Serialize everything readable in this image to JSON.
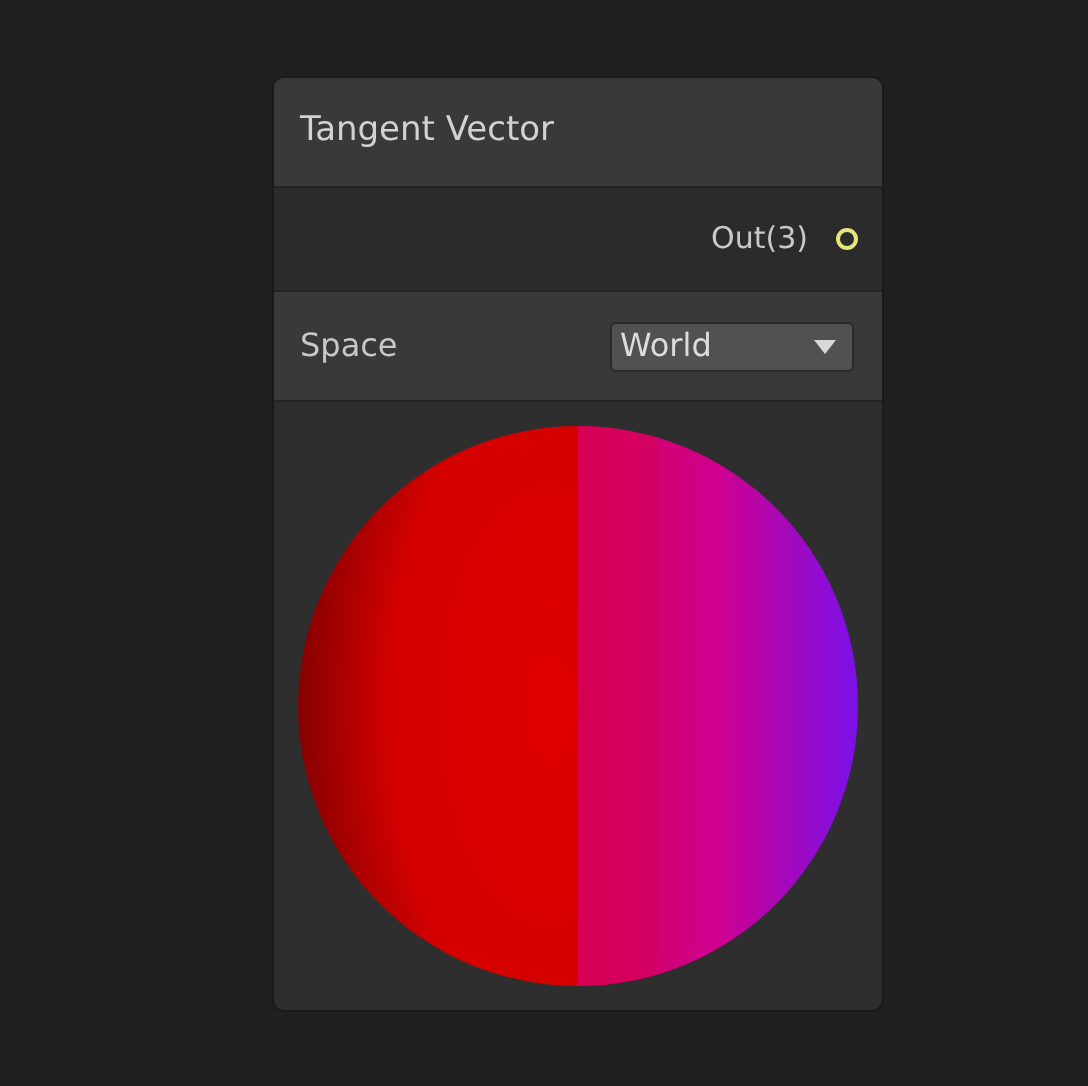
{
  "node": {
    "title": "Tangent Vector",
    "outputs": [
      {
        "label": "Out(3)",
        "connected": false
      }
    ],
    "controls": [
      {
        "label": "Space",
        "value": "World"
      }
    ]
  }
}
